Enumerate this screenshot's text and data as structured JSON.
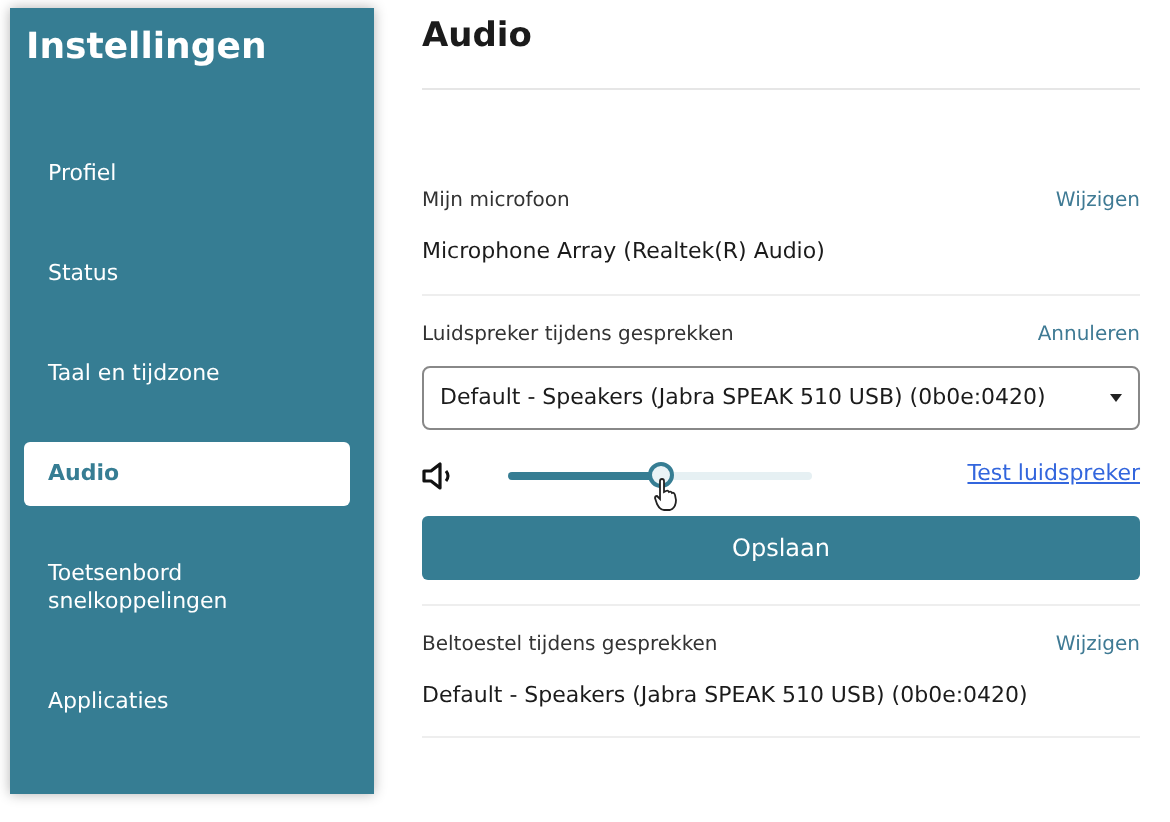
{
  "sidebar": {
    "title": "Instellingen",
    "items": [
      {
        "label": "Profiel",
        "selected": false
      },
      {
        "label": "Status",
        "selected": false
      },
      {
        "label": "Taal en tijdzone",
        "selected": false
      },
      {
        "label": "Audio",
        "selected": true
      },
      {
        "label": "Toetsenbord snelkoppelingen",
        "selected": false
      },
      {
        "label": "Applicaties",
        "selected": false
      }
    ]
  },
  "page": {
    "title": "Audio"
  },
  "sections": [
    {
      "kind": "device",
      "label": "Mijn microfoon",
      "action": "Wijzigen",
      "value": "Microphone Array (Realtek(R) Audio)"
    },
    {
      "kind": "edit",
      "label": "Luidspreker tijdens gesprekken",
      "action": "Annuleren",
      "select": "Default - Speakers (Jabra SPEAK 510 USB) (0b0e:0420)",
      "level": 0.5,
      "link": "Test luidspreker",
      "button": "Opslaan"
    },
    {
      "kind": "device",
      "label": "Beltoestel tijdens gesprekken",
      "action": "Wijzigen",
      "value": "Default - Speakers (Jabra SPEAK 510 USB) (0b0e:0420)"
    }
  ]
}
